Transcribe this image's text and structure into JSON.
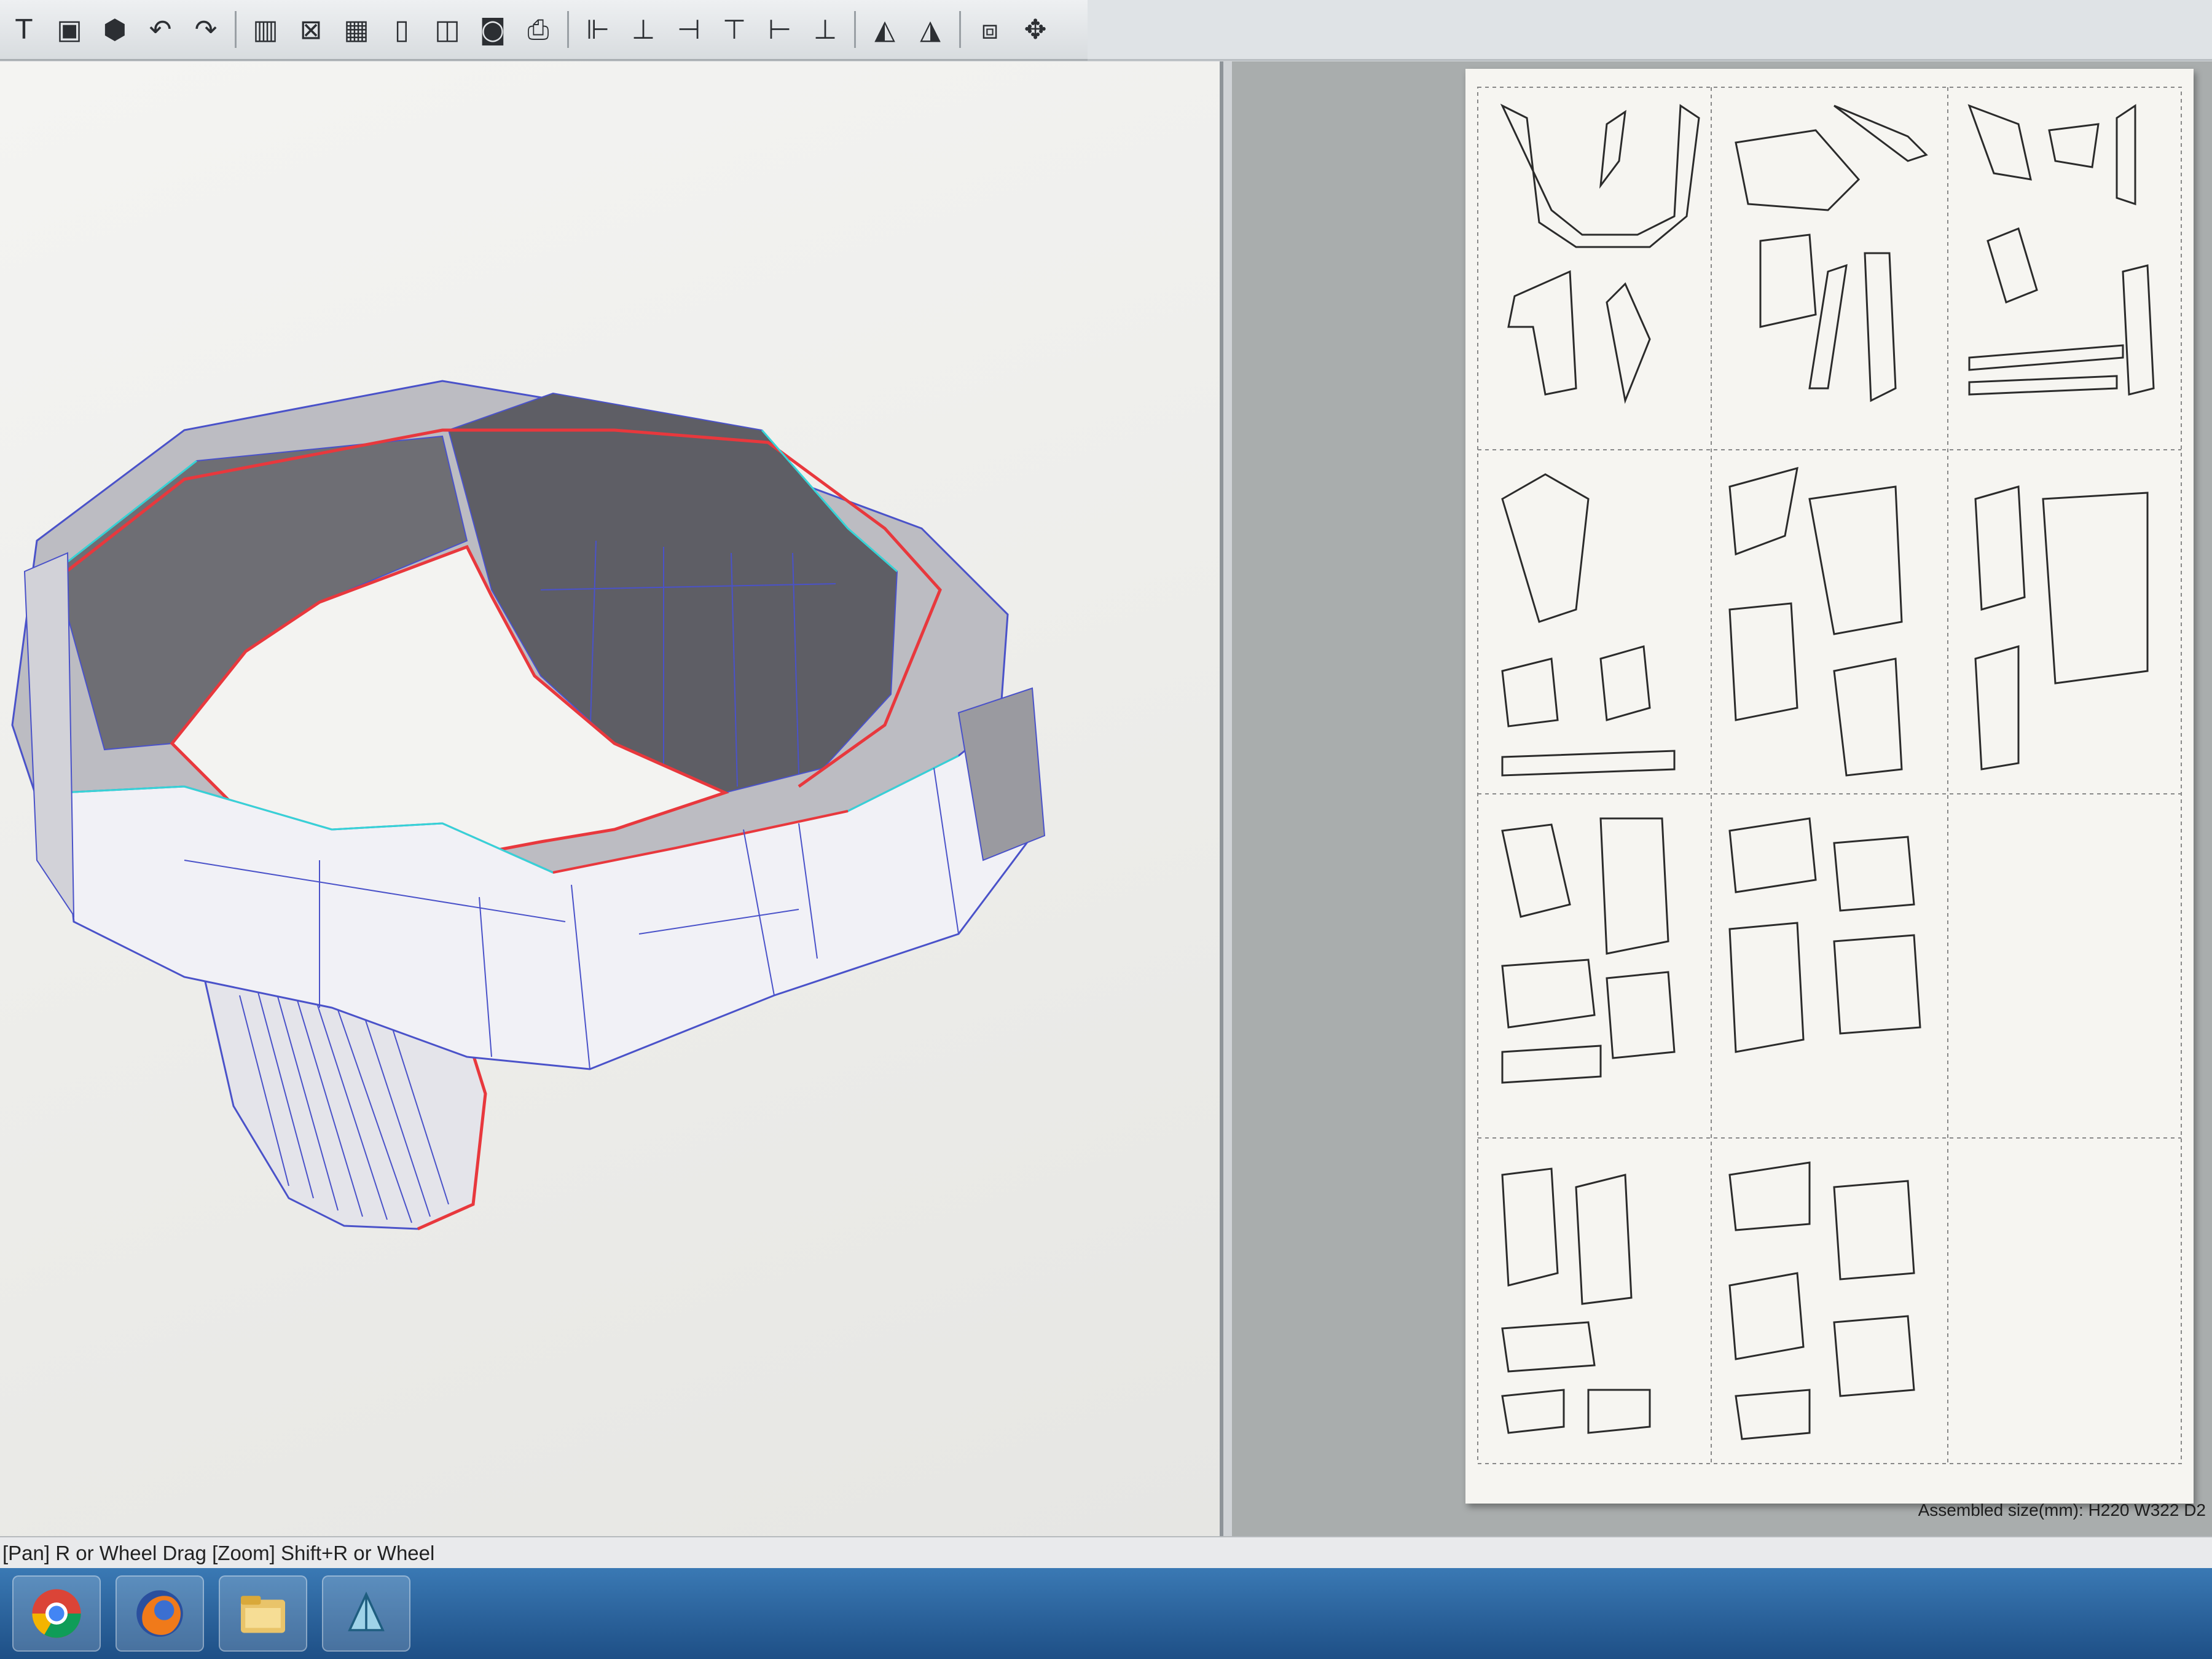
{
  "toolbar": {
    "items": [
      {
        "name": "text-tool-icon",
        "glyph": "T"
      },
      {
        "name": "image-tool-icon",
        "glyph": "▣"
      },
      {
        "name": "cube-icon",
        "glyph": "⬢"
      },
      {
        "name": "undo-icon",
        "glyph": "↶"
      },
      {
        "name": "redo-icon",
        "glyph": "↷"
      },
      {
        "name": "sep"
      },
      {
        "name": "book-icon",
        "glyph": "▥"
      },
      {
        "name": "unfold-icon",
        "glyph": "⊠"
      },
      {
        "name": "grid-icon",
        "glyph": "▦"
      },
      {
        "name": "page-icon",
        "glyph": "▯"
      },
      {
        "name": "page-layout-icon",
        "glyph": "◫"
      },
      {
        "name": "settings-icon",
        "glyph": "◙"
      },
      {
        "name": "print-icon",
        "glyph": "⎙"
      },
      {
        "name": "sep"
      },
      {
        "name": "align-left-icon",
        "glyph": "⊩"
      },
      {
        "name": "align-center-icon",
        "glyph": "⊥"
      },
      {
        "name": "align-right-icon",
        "glyph": "⊣"
      },
      {
        "name": "align-top-icon",
        "glyph": "⊤"
      },
      {
        "name": "align-middle-icon",
        "glyph": "⊢"
      },
      {
        "name": "align-bottom-icon",
        "glyph": "⊥"
      },
      {
        "name": "sep"
      },
      {
        "name": "flip-h-icon",
        "glyph": "◭"
      },
      {
        "name": "flip-v-icon",
        "glyph": "◮"
      },
      {
        "name": "sep"
      },
      {
        "name": "fit-icon",
        "glyph": "⧈"
      },
      {
        "name": "move-icon",
        "glyph": "✥"
      }
    ]
  },
  "paper": {
    "assembled_size": "Assembled size(mm): H220 W322 D2"
  },
  "status": {
    "hint": "[Pan] R or Wheel Drag [Zoom] Shift+R or Wheel"
  },
  "taskbar": {
    "apps": [
      "chrome-icon",
      "firefox-icon",
      "file-explorer-icon",
      "pepakura-icon"
    ]
  },
  "colors": {
    "edge_red": "#e8383d",
    "edge_cyan": "#36d3d6",
    "edge_blue": "#4a52c9",
    "model_fill": "#f1f1f6",
    "model_shadow": "#9a9aa0"
  }
}
